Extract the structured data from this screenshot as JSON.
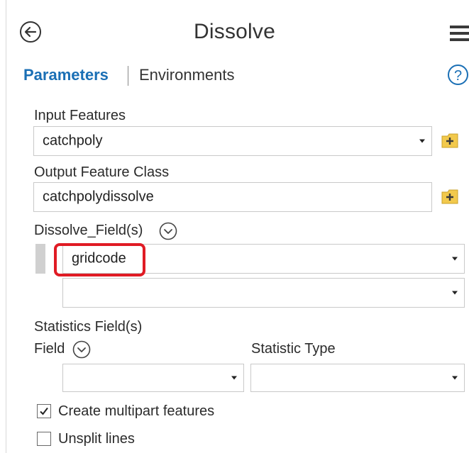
{
  "header": {
    "title": "Dissolve",
    "back_icon": "back-arrow-circle-icon",
    "menu_icon": "hamburger-menu-icon"
  },
  "tabs": {
    "parameters": "Parameters",
    "environments": "Environments",
    "help_icon": "help-question-icon",
    "active_color": "#1a6fb5"
  },
  "input_features": {
    "label": "Input Features",
    "value": "catchpoly"
  },
  "output_feature_class": {
    "label": "Output Feature Class",
    "value": "catchpolydissolve"
  },
  "dissolve_fields": {
    "label": "Dissolve_Field(s)",
    "values": [
      "gridcode",
      ""
    ]
  },
  "statistics": {
    "label": "Statistics Field(s)",
    "field_label": "Field",
    "type_label": "Statistic Type",
    "field_value": "",
    "type_value": ""
  },
  "options": {
    "multipart": {
      "label": "Create multipart features",
      "checked": true
    },
    "unsplit": {
      "label": "Unsplit lines",
      "checked": false
    }
  },
  "colors": {
    "highlight": "#e01b24",
    "folder": "#f2c94c"
  }
}
